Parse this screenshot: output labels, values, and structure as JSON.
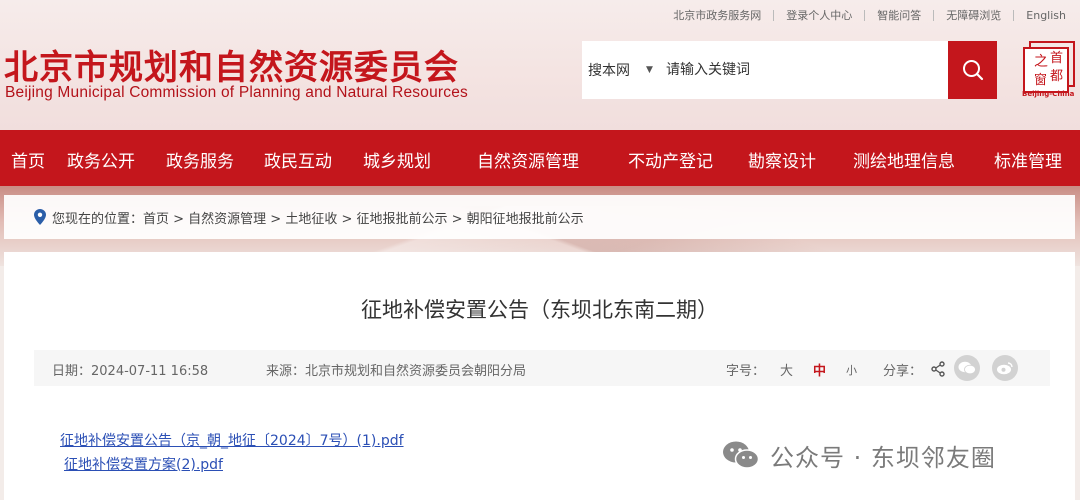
{
  "topbar": {
    "links": [
      "北京市政务服务网",
      "登录个人中心",
      "智能问答",
      "无障碍浏览",
      "English"
    ]
  },
  "header": {
    "title_cn": "北京市规划和自然资源委员会",
    "title_en": "Beijing Municipal Commission of Planning and Natural Resources",
    "seal_chars": [
      "首",
      "都",
      "之",
      "窗"
    ],
    "seal_caption": "Beijing-China"
  },
  "search": {
    "scope": "搜本网",
    "placeholder": "请输入关键词",
    "icon": "search-icon"
  },
  "nav": {
    "items": [
      "首页",
      "政务公开",
      "政务服务",
      "政民互动",
      "城乡规划",
      "自然资源管理",
      "不动产登记",
      "勘察设计",
      "测绘地理信息",
      "标准管理"
    ]
  },
  "breadcrumb": {
    "text": "您现在的位置：首页 > 自然资源管理 > 土地征收 > 征地报批前公示 > 朝阳征地报批前公示"
  },
  "article": {
    "title": "征地补偿安置公告（东坝北东南二期）",
    "date": "日期：2024-07-11 16:58",
    "source": "来源：北京市规划和自然资源委员会朝阳分局",
    "font_label": "字号：",
    "font_large": "大",
    "font_medium": "中",
    "font_small": "小",
    "share_label": "分享："
  },
  "attachments": [
    "征地补偿安置公告（京_朝_地征〔2024〕7号）(1).pdf",
    "征地补偿安置方案(2).pdf"
  ],
  "watermark": {
    "text": "公众号 · 东坝邻友圈",
    "icon": "wechat-icon"
  },
  "colors": {
    "brand_red": "#c4161c",
    "link_blue": "#2b4fb5"
  }
}
